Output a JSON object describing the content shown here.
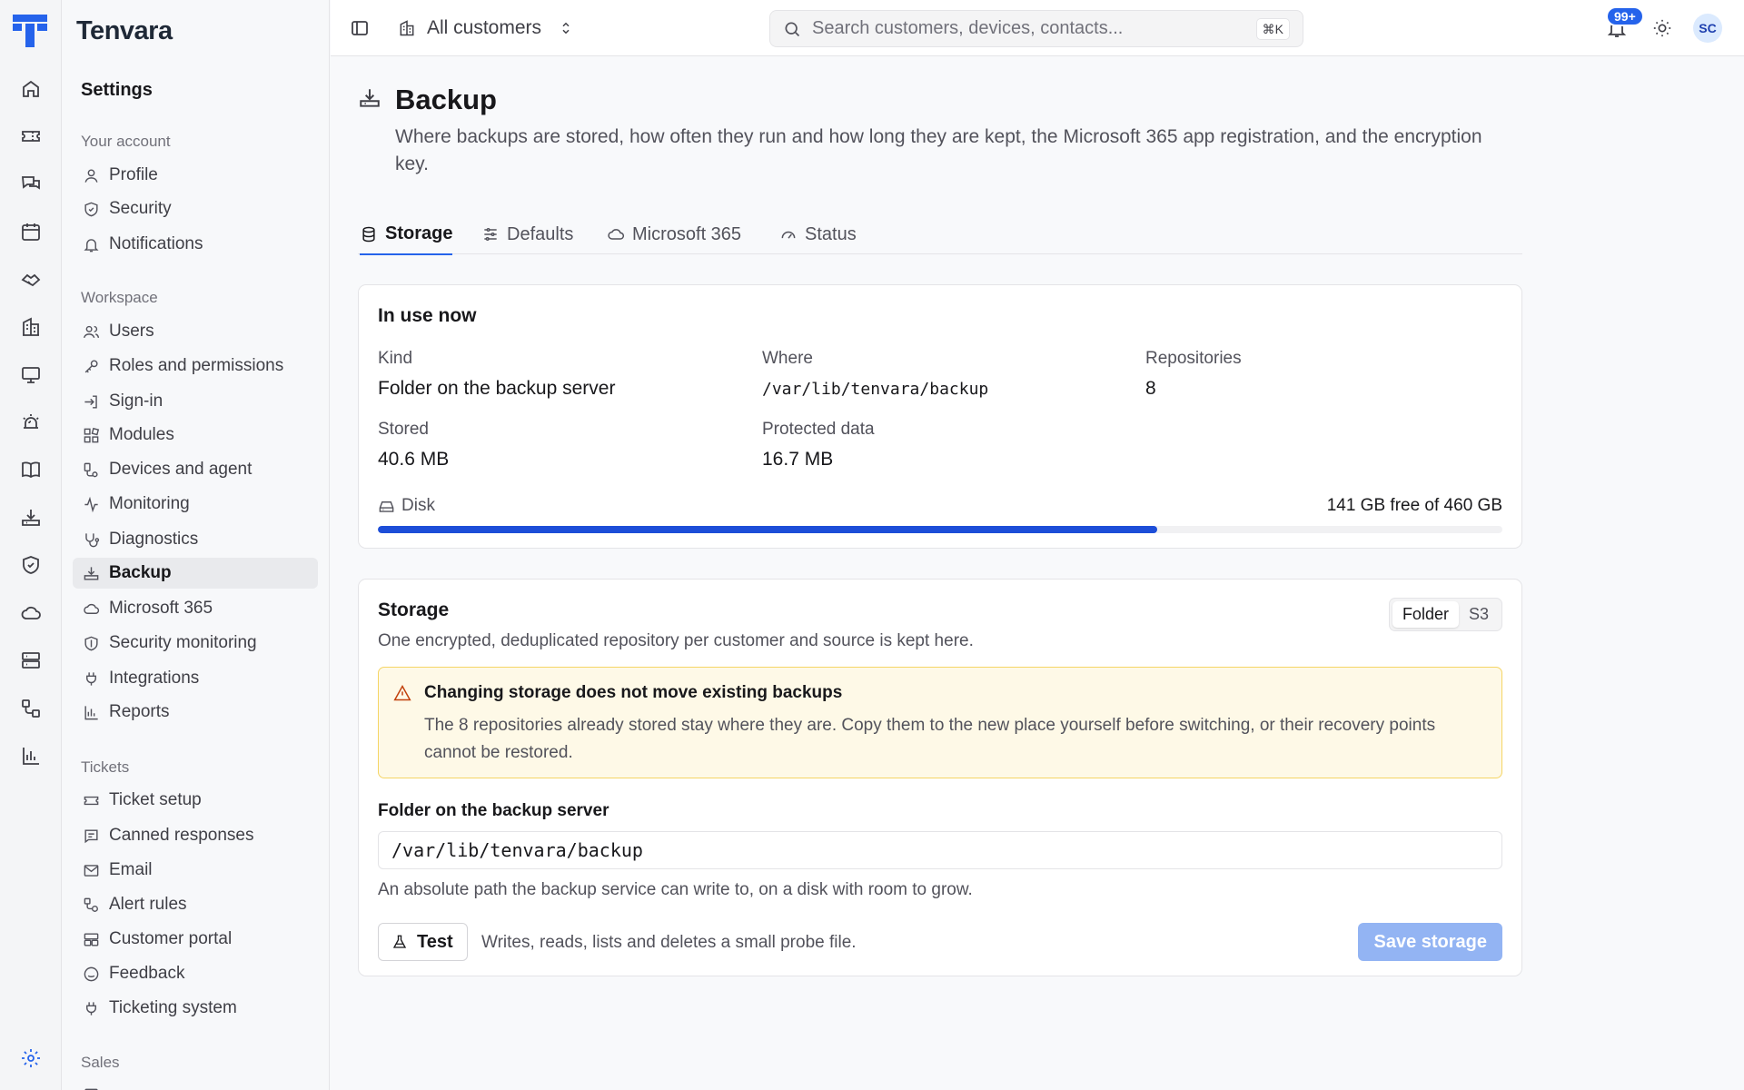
{
  "app": {
    "brand": "Tenvara"
  },
  "topbar": {
    "customer_selector": "All customers",
    "search_placeholder": "Search customers, devices, contacts...",
    "search_shortcut": "⌘K",
    "notification_count": "99+",
    "avatar_initials": "SC"
  },
  "rail": {
    "icons": [
      "home-icon",
      "tickets-icon",
      "chat-icon",
      "calendar-icon",
      "handshake-icon",
      "building-icon",
      "monitor-icon",
      "alarm-icon",
      "book-icon",
      "backup-icon",
      "shield-icon",
      "cloud-icon",
      "servers-icon",
      "workflow-icon",
      "chart-icon",
      "settings-icon"
    ]
  },
  "sidebar": {
    "title": "Settings",
    "groups": [
      {
        "label": "Your account",
        "items": [
          "Profile",
          "Security",
          "Notifications"
        ]
      },
      {
        "label": "Workspace",
        "items": [
          "Users",
          "Roles and permissions",
          "Sign-in",
          "Modules",
          "Devices and agent",
          "Monitoring",
          "Diagnostics",
          "Backup",
          "Microsoft 365",
          "Security monitoring",
          "Integrations",
          "Reports"
        ]
      },
      {
        "label": "Tickets",
        "items": [
          "Ticket setup",
          "Canned responses",
          "Email",
          "Alert rules",
          "Customer portal",
          "Feedback",
          "Ticketing system"
        ]
      },
      {
        "label": "Sales",
        "items": []
      }
    ],
    "active": "Backup"
  },
  "page": {
    "title": "Backup",
    "description": "Where backups are stored, how often they run and how long they are kept, the Microsoft 365 app registration, and the encryption key."
  },
  "tabs": [
    {
      "label": "Storage",
      "active": true
    },
    {
      "label": "Defaults",
      "active": false
    },
    {
      "label": "Microsoft 365",
      "active": false
    },
    {
      "label": "Status",
      "active": false
    }
  ],
  "in_use": {
    "heading": "In use now",
    "kind_label": "Kind",
    "kind_value": "Folder on the backup server",
    "where_label": "Where",
    "where_value": "/var/lib/tenvara/backup",
    "repos_label": "Repositories",
    "repos_value": "8",
    "stored_label": "Stored",
    "stored_value": "40.6 MB",
    "protected_label": "Protected data",
    "protected_value": "16.7 MB",
    "disk_label": "Disk",
    "disk_free": "141 GB free of 460 GB",
    "disk_used_fraction": 0.693
  },
  "storage": {
    "heading": "Storage",
    "subtitle": "One encrypted, deduplicated repository per customer and source is kept here.",
    "options": [
      "Folder",
      "S3"
    ],
    "selected_option": "Folder",
    "warning_title": "Changing storage does not move existing backups",
    "warning_body": "The 8 repositories already stored stay where they are. Copy them to the new place yourself before switching, or their recovery points cannot be restored.",
    "field_label": "Folder on the backup server",
    "field_value": "/var/lib/tenvara/backup",
    "help": "An absolute path the backup service can write to, on a disk with room to grow.",
    "test_label": "Test",
    "test_note": "Writes, reads, lists and deletes a small probe file.",
    "save_label": "Save storage"
  },
  "colors": {
    "accent": "#2563eb",
    "bar": "#1d4ed8",
    "warning_bg": "#fef9e7",
    "warning_border": "#f5d565",
    "save_disabled": "#93b4f3"
  }
}
